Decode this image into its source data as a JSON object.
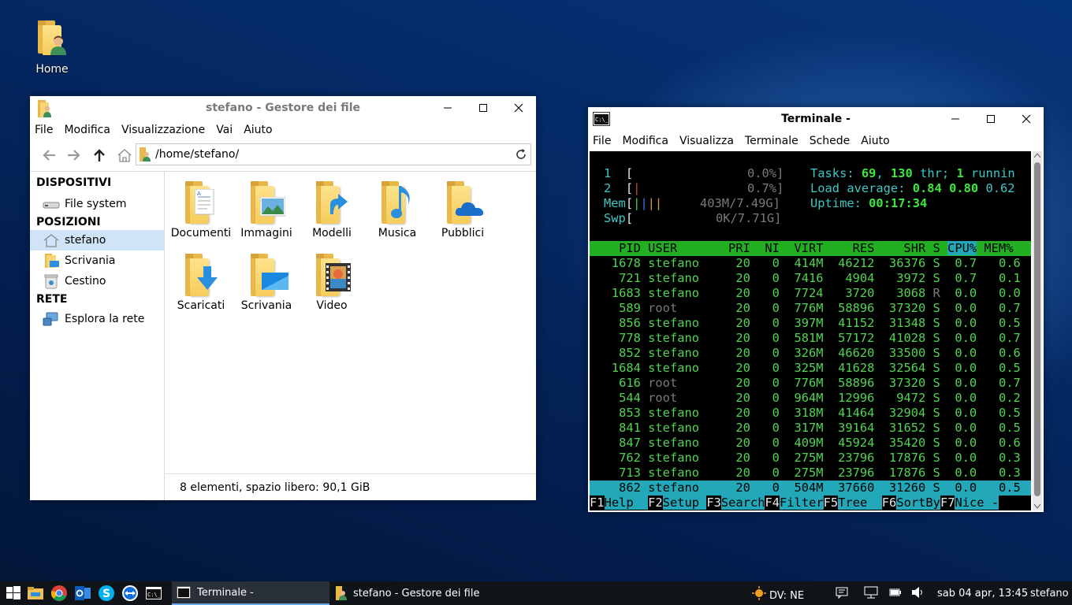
{
  "desktop": {
    "home_label": "Home"
  },
  "file_manager": {
    "title": "stefano - Gestore dei file",
    "menu": [
      "File",
      "Modifica",
      "Visualizzazione",
      "Vai",
      "Aiuto"
    ],
    "path": "/home/stefano/",
    "sidebar": {
      "dispositivi_header": "DISPOSITIVI",
      "filesystem": "File system",
      "posizioni_header": "POSIZIONI",
      "stefano": "stefano",
      "scrivania": "Scrivania",
      "cestino": "Cestino",
      "rete_header": "RETE",
      "esplora": "Esplora la rete"
    },
    "items": [
      "Documenti",
      "Immagini",
      "Modelli",
      "Musica",
      "Pubblici",
      "Scaricati",
      "Scrivania",
      "Video"
    ],
    "status": "8 elementi, spazio libero: 90,1 GiB"
  },
  "terminal": {
    "title": "Terminale -",
    "menu": [
      "File",
      "Modifica",
      "Visualizza",
      "Terminale",
      "Schede",
      "Aiuto"
    ],
    "cpu1_label": "1",
    "cpu1_pct": "0.0%]",
    "cpu2_label": "2",
    "cpu2_pct": "0.7%]",
    "mem_label": "Mem",
    "mem_value": "403M/7.49G]",
    "swp_label": "Swp",
    "swp_value": "0K/7.71G]",
    "tasks_label": "Tasks:",
    "tasks_count": "69",
    "threads_count": "130",
    "threads_label": "thr;",
    "running_count": "1",
    "running_label": "runnin",
    "load_label": "Load average:",
    "load1": "0.84",
    "load5": "0.80",
    "load15": "0.62",
    "uptime_label": "Uptime:",
    "uptime_value": "00:17:34",
    "columns": {
      "pid": "PID",
      "user": "USER",
      "pri": "PRI",
      "ni": "NI",
      "virt": "VIRT",
      "res": "RES",
      "shr": "SHR",
      "s": "S",
      "cpu": "CPU%",
      "mem": "MEM%"
    },
    "processes": [
      {
        "pid": "1678",
        "user": "stefano",
        "pri": "20",
        "ni": "0",
        "virt": "414M",
        "res": "46212",
        "shr": "36376",
        "s": "S",
        "cpu": "0.7",
        "mem": "0.6"
      },
      {
        "pid": "721",
        "user": "stefano",
        "pri": "20",
        "ni": "0",
        "virt": "7416",
        "res": "4904",
        "shr": "3972",
        "s": "S",
        "cpu": "0.7",
        "mem": "0.1"
      },
      {
        "pid": "1683",
        "user": "stefano",
        "pri": "20",
        "ni": "0",
        "virt": "7724",
        "res": "3720",
        "shr": "3068",
        "s": "R",
        "cpu": "0.0",
        "mem": "0.0"
      },
      {
        "pid": "589",
        "user": "root",
        "pri": "20",
        "ni": "0",
        "virt": "776M",
        "res": "58896",
        "shr": "37320",
        "s": "S",
        "cpu": "0.0",
        "mem": "0.7"
      },
      {
        "pid": "856",
        "user": "stefano",
        "pri": "20",
        "ni": "0",
        "virt": "397M",
        "res": "41152",
        "shr": "31348",
        "s": "S",
        "cpu": "0.0",
        "mem": "0.5"
      },
      {
        "pid": "778",
        "user": "stefano",
        "pri": "20",
        "ni": "0",
        "virt": "581M",
        "res": "57172",
        "shr": "41028",
        "s": "S",
        "cpu": "0.0",
        "mem": "0.7"
      },
      {
        "pid": "852",
        "user": "stefano",
        "pri": "20",
        "ni": "0",
        "virt": "326M",
        "res": "46620",
        "shr": "33500",
        "s": "S",
        "cpu": "0.0",
        "mem": "0.6"
      },
      {
        "pid": "1684",
        "user": "stefano",
        "pri": "20",
        "ni": "0",
        "virt": "325M",
        "res": "41628",
        "shr": "32564",
        "s": "S",
        "cpu": "0.0",
        "mem": "0.5"
      },
      {
        "pid": "616",
        "user": "root",
        "pri": "20",
        "ni": "0",
        "virt": "776M",
        "res": "58896",
        "shr": "37320",
        "s": "S",
        "cpu": "0.0",
        "mem": "0.7"
      },
      {
        "pid": "544",
        "user": "root",
        "pri": "20",
        "ni": "0",
        "virt": "964M",
        "res": "12996",
        "shr": "9472",
        "s": "S",
        "cpu": "0.0",
        "mem": "0.2"
      },
      {
        "pid": "853",
        "user": "stefano",
        "pri": "20",
        "ni": "0",
        "virt": "318M",
        "res": "41464",
        "shr": "32904",
        "s": "S",
        "cpu": "0.0",
        "mem": "0.5"
      },
      {
        "pid": "841",
        "user": "stefano",
        "pri": "20",
        "ni": "0",
        "virt": "317M",
        "res": "39164",
        "shr": "31652",
        "s": "S",
        "cpu": "0.0",
        "mem": "0.5"
      },
      {
        "pid": "847",
        "user": "stefano",
        "pri": "20",
        "ni": "0",
        "virt": "409M",
        "res": "45924",
        "shr": "35420",
        "s": "S",
        "cpu": "0.0",
        "mem": "0.6"
      },
      {
        "pid": "762",
        "user": "stefano",
        "pri": "20",
        "ni": "0",
        "virt": "275M",
        "res": "23796",
        "shr": "17876",
        "s": "S",
        "cpu": "0.0",
        "mem": "0.3"
      },
      {
        "pid": "713",
        "user": "stefano",
        "pri": "20",
        "ni": "0",
        "virt": "275M",
        "res": "23796",
        "shr": "17876",
        "s": "S",
        "cpu": "0.0",
        "mem": "0.3"
      },
      {
        "pid": "862",
        "user": "stefano",
        "pri": "20",
        "ni": "0",
        "virt": "504M",
        "res": "37660",
        "shr": "31260",
        "s": "S",
        "cpu": "0.0",
        "mem": "0.5"
      }
    ],
    "fkeys": [
      {
        "key": "F1",
        "label": "Help  "
      },
      {
        "key": "F2",
        "label": "Setup "
      },
      {
        "key": "F3",
        "label": "Search"
      },
      {
        "key": "F4",
        "label": "Filter"
      },
      {
        "key": "F5",
        "label": "Tree  "
      },
      {
        "key": "F6",
        "label": "SortBy"
      },
      {
        "key": "F7",
        "label": "Nice -"
      }
    ]
  },
  "taskbar": {
    "task_terminal": "Terminale -",
    "task_fm": "stefano - Gestore dei file",
    "weather": "DV: NE",
    "clock": "sab 04 apr, 13:45",
    "user": "stefano"
  },
  "colors": {
    "terminal_green": "#22b022",
    "terminal_cyan": "#22a8b8",
    "selection_blue": "#cfe4f7"
  }
}
